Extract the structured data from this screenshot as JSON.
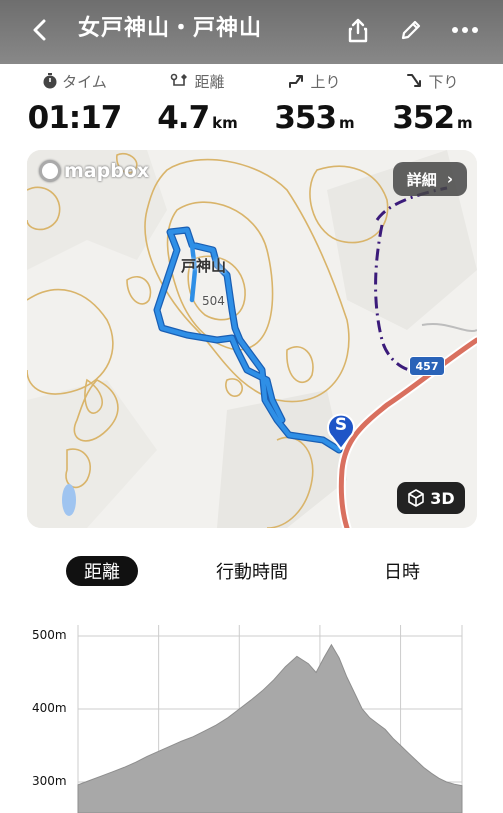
{
  "header": {
    "title": "女戸神山・戸神山",
    "back_icon": "chevron-left-icon",
    "share_icon": "share-icon",
    "edit_icon": "pencil-icon",
    "more_icon": "more-horizontal-icon"
  },
  "stats": [
    {
      "key": "time",
      "label": "タイム",
      "icon": "stopwatch-icon",
      "value": "01:17",
      "unit": ""
    },
    {
      "key": "distance",
      "label": "距離",
      "icon": "route-icon",
      "value": "4.7",
      "unit": "km"
    },
    {
      "key": "ascent",
      "label": "上り",
      "icon": "arrow-up-right-icon",
      "value": "353",
      "unit": "m"
    },
    {
      "key": "descent",
      "label": "下り",
      "icon": "arrow-down-right-icon",
      "value": "352",
      "unit": "m"
    }
  ],
  "map": {
    "attribution": "mapbox",
    "detail_label": "詳細",
    "detail_chevron": "›",
    "peak_name": "戸神山",
    "peak_elevation": "504",
    "road_number": "457",
    "start_marker_letter": "S",
    "three_d_label": "3D",
    "colors": {
      "route": "#2f8fe6",
      "road": "#d9705f",
      "contour": "#d9b46a",
      "boundary": "#3b1b7a"
    }
  },
  "tabs": [
    {
      "label": "距離",
      "active": true
    },
    {
      "label": "行動時間",
      "active": false
    },
    {
      "label": "日時",
      "active": false
    }
  ],
  "elevation_chart": {
    "y_labels": [
      "500m",
      "400m",
      "300m"
    ],
    "profile": [
      [
        0,
        296
      ],
      [
        3,
        302
      ],
      [
        6,
        308
      ],
      [
        9,
        314
      ],
      [
        12,
        320
      ],
      [
        15,
        327
      ],
      [
        18,
        335
      ],
      [
        21,
        342
      ],
      [
        24,
        349
      ],
      [
        27,
        356
      ],
      [
        30,
        362
      ],
      [
        33,
        370
      ],
      [
        36,
        378
      ],
      [
        39,
        388
      ],
      [
        42,
        400
      ],
      [
        45,
        412
      ],
      [
        48,
        425
      ],
      [
        51,
        440
      ],
      [
        54,
        458
      ],
      [
        57,
        472
      ],
      [
        60,
        462
      ],
      [
        62,
        450
      ],
      [
        64,
        470
      ],
      [
        66,
        488
      ],
      [
        68,
        470
      ],
      [
        70,
        444
      ],
      [
        72,
        422
      ],
      [
        74,
        400
      ],
      [
        76,
        388
      ],
      [
        78,
        380
      ],
      [
        80,
        372
      ],
      [
        82,
        360
      ],
      [
        84,
        350
      ],
      [
        86,
        340
      ],
      [
        88,
        330
      ],
      [
        90,
        320
      ],
      [
        92,
        312
      ],
      [
        94,
        305
      ],
      [
        96,
        300
      ],
      [
        98,
        297
      ],
      [
        100,
        295
      ]
    ],
    "colors": {
      "fill": "#a8a8a8",
      "grid": "#cccccc"
    }
  }
}
